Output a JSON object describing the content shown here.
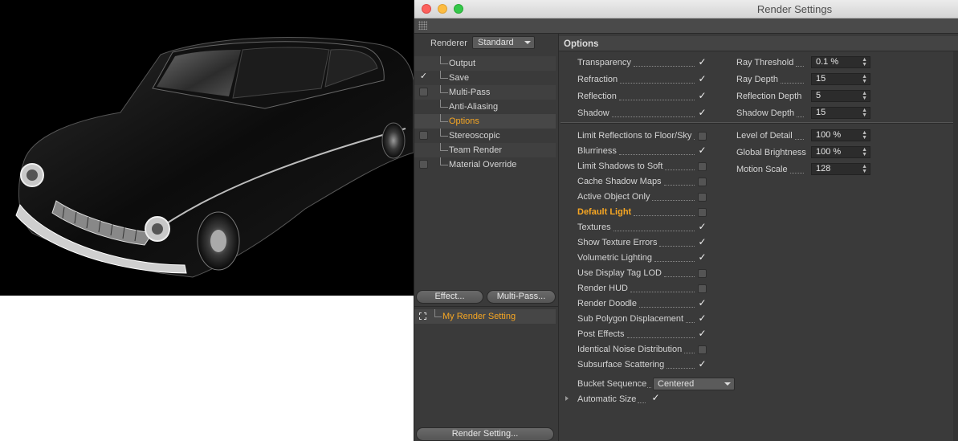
{
  "window": {
    "title": "Render Settings"
  },
  "sidebar": {
    "renderer_label": "Renderer",
    "renderer_value": "Standard",
    "items": [
      {
        "label": "Output",
        "check": "none",
        "active": false
      },
      {
        "label": "Save",
        "check": "checked",
        "active": false
      },
      {
        "label": "Multi-Pass",
        "check": "unchecked",
        "active": false
      },
      {
        "label": "Anti-Aliasing",
        "check": "none",
        "active": false
      },
      {
        "label": "Options",
        "check": "none",
        "active": true
      },
      {
        "label": "Stereoscopic",
        "check": "unchecked",
        "active": false
      },
      {
        "label": "Team Render",
        "check": "none",
        "active": false
      },
      {
        "label": "Material Override",
        "check": "unchecked",
        "active": false
      }
    ],
    "effect_button": "Effect...",
    "multipass_button": "Multi-Pass...",
    "render_setting_name": "My Render Setting",
    "render_setting_button": "Render Setting..."
  },
  "options": {
    "section_title": "Options",
    "top_left": [
      {
        "label": "Transparency",
        "checked": true
      },
      {
        "label": "Refraction",
        "checked": true
      },
      {
        "label": "Reflection",
        "checked": true
      },
      {
        "label": "Shadow",
        "checked": true
      }
    ],
    "top_right": [
      {
        "label": "Ray Threshold",
        "value": "0.1 %"
      },
      {
        "label": "Ray Depth",
        "value": "15"
      },
      {
        "label": "Reflection Depth",
        "value": "5"
      },
      {
        "label": "Shadow Depth",
        "value": "15"
      }
    ],
    "lower_left": [
      {
        "label": "Limit Reflections to Floor/Sky",
        "checked": false
      },
      {
        "label": "Blurriness",
        "checked": true
      },
      {
        "label": "Limit Shadows to Soft",
        "checked": false
      },
      {
        "label": "Cache Shadow Maps",
        "checked": false
      },
      {
        "label": "Active Object Only",
        "checked": false
      },
      {
        "label": "Default Light",
        "checked": false,
        "highlight": true
      },
      {
        "label": "Textures",
        "checked": true
      },
      {
        "label": "Show Texture Errors",
        "checked": true
      },
      {
        "label": "Volumetric Lighting",
        "checked": true
      },
      {
        "label": "Use Display Tag LOD",
        "checked": false
      },
      {
        "label": "Render HUD",
        "checked": false
      },
      {
        "label": "Render Doodle",
        "checked": true
      },
      {
        "label": "Sub Polygon Displacement",
        "checked": true
      },
      {
        "label": "Post Effects",
        "checked": true
      },
      {
        "label": "Identical Noise Distribution",
        "checked": false
      },
      {
        "label": "Subsurface Scattering",
        "checked": true
      }
    ],
    "lower_right": [
      {
        "label": "Level of Detail",
        "value": "100 %"
      },
      {
        "label": "Global Brightness",
        "value": "100 %"
      },
      {
        "label": "Motion Scale",
        "value": "128"
      }
    ],
    "bucket_label": "Bucket Sequence",
    "bucket_value": "Centered",
    "autosize_label": "Automatic Size",
    "autosize_checked": true
  },
  "colors": {
    "accent": "#f6a623",
    "panel": "#3a3a3a",
    "field": "#2c2c2c"
  }
}
